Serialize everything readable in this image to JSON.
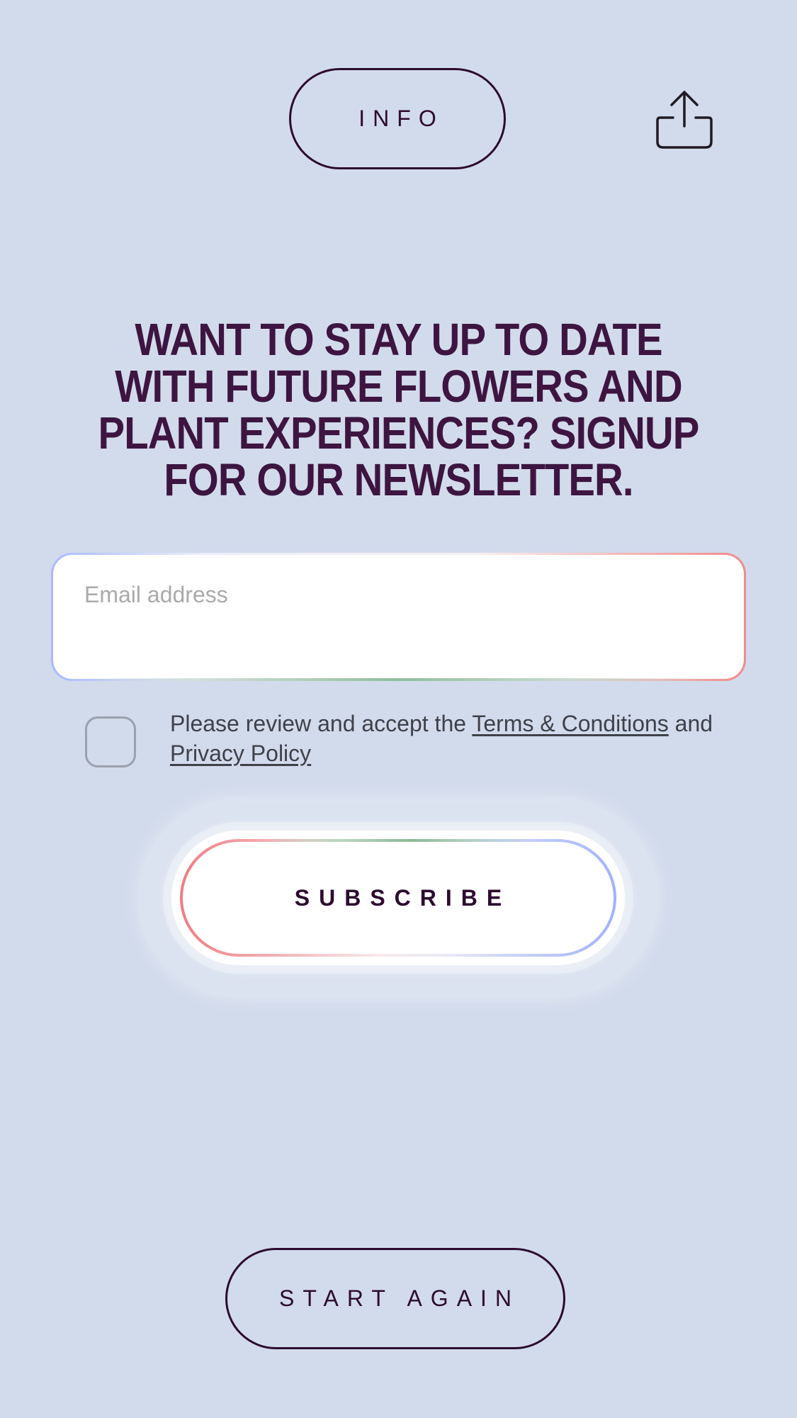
{
  "header": {
    "info_label": "INFO",
    "share_icon": "share-icon"
  },
  "main": {
    "headline": "WANT TO STAY UP TO DATE WITH FUTURE FLOWERS AND PLANT EXPERIENCES? SIGNUP FOR OUR NEWSLETTER.",
    "email": {
      "value": "",
      "placeholder": "Email address"
    },
    "terms": {
      "checked": false,
      "prefix": "Please review and accept the ",
      "terms_link": "Terms & Conditions",
      "middle": " and ",
      "privacy_link": "Privacy Policy"
    },
    "subscribe_label": "SUBSCRIBE"
  },
  "footer": {
    "start_again_label": "START AGAIN"
  },
  "colors": {
    "background": "#d2dbec",
    "headline": "#3d1540",
    "outline": "#2d0b2f",
    "text": "#3f4149"
  }
}
